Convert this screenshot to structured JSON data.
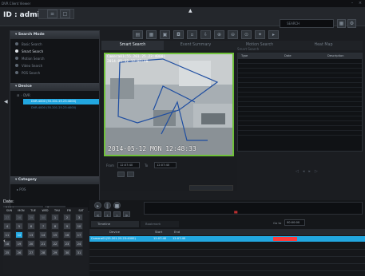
{
  "title_bar": {
    "app_title": "DVR Client Viewer"
  },
  "header": {
    "id_label": "ID : admin",
    "search_label": "SEARCH"
  },
  "left": {
    "search_mode_header": "Search Mode",
    "modes": [
      "Basic Search",
      "Smart Search",
      "Motion Search",
      "Video Search",
      "POS Search"
    ],
    "device_header": "Device",
    "device_root": "DVR",
    "device_item": "DVR-4000 (55.201.25.23:4000)",
    "device_sub": "DVR-4000 (55.201.25.23:4000)",
    "category_header": "Category",
    "category_item": "POS"
  },
  "tabs": [
    "Smart Search",
    "Event Summary",
    "Motion Search",
    "Heat Map"
  ],
  "video": {
    "overlay_top": "Camera01(55.201.25.23:4000)",
    "overlay_time": "2014-05-12 12:07:40",
    "osd": "2014-05-12 MON 12:48:33"
  },
  "grid": {
    "caption": "Smart Search",
    "columns": [
      "Type",
      "Date",
      "Description"
    ]
  },
  "controls": {
    "start_label": "From",
    "start_val": "12:07:40",
    "end_label": "To",
    "end_val": "12:07:40"
  },
  "calendar": {
    "year": "2014",
    "month": "5",
    "days_header": [
      "SUN",
      "MON",
      "TUE",
      "WED",
      "THU",
      "FRI",
      "SAT"
    ],
    "weeks": [
      [
        "27",
        "28",
        "29",
        "30",
        "1",
        "2",
        "3"
      ],
      [
        "4",
        "5",
        "6",
        "7",
        "8",
        "9",
        "10"
      ],
      [
        "11",
        "12",
        "13",
        "14",
        "15",
        "16",
        "17"
      ],
      [
        "18",
        "19",
        "20",
        "21",
        "22",
        "23",
        "24"
      ],
      [
        "25",
        "26",
        "27",
        "28",
        "29",
        "30",
        "31"
      ]
    ]
  },
  "timeline": {
    "tabs": [
      "Timeline",
      "Bookmark"
    ],
    "cols": [
      "Device",
      "Start",
      "End"
    ],
    "row_device": "Camera01(55.201.25.23:4000)",
    "row_start": "12:07:40",
    "row_end": "12:07:40",
    "goto_label": "Go to",
    "goto_val": "00:00:00"
  },
  "colors": {
    "accent": "#22a7e0",
    "green": "#6fc13a",
    "red": "#ff3b3b"
  }
}
